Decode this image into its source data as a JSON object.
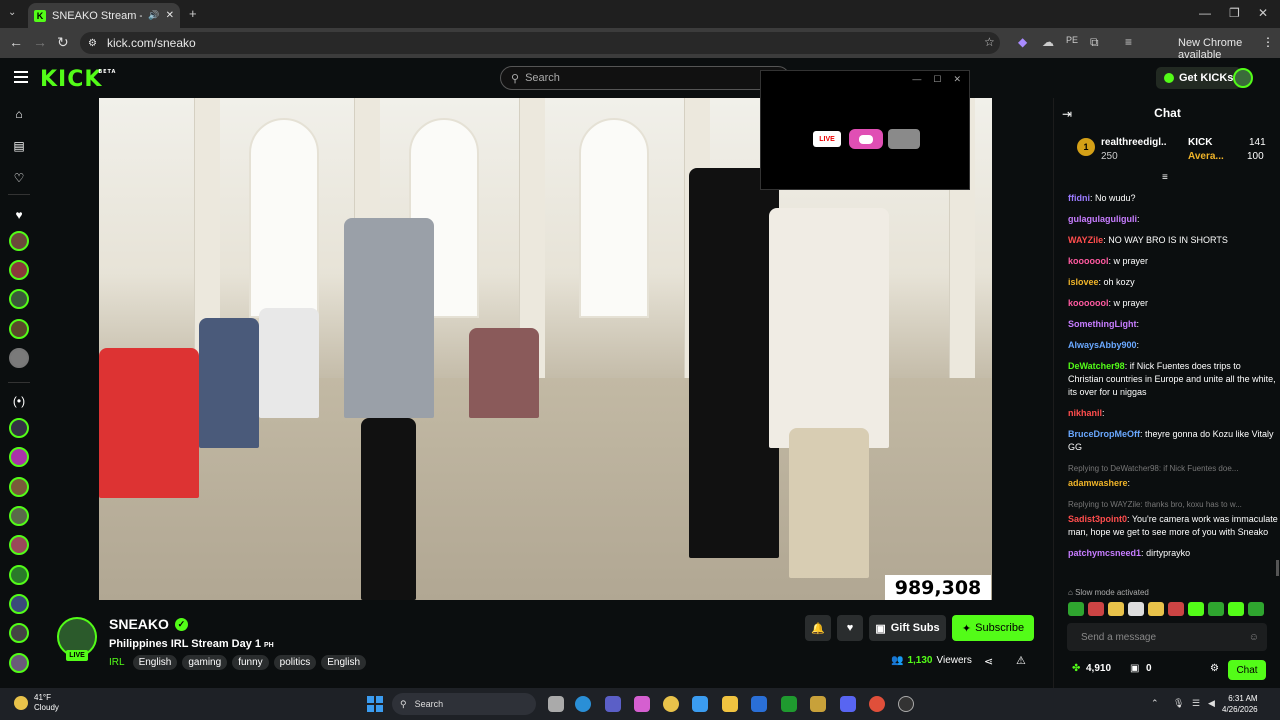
{
  "browser": {
    "tab_title": "SNEAKO Stream - Watch Li",
    "url": "kick.com/sneako",
    "new_chrome": "New Chrome available"
  },
  "header": {
    "logo": "KICK",
    "logo_badge": "BETA",
    "search_placeholder": "Search",
    "get_kicks": "Get KICKs"
  },
  "player": {
    "viewer_overlay": "989,308",
    "overlay_live": "LIVE"
  },
  "channel": {
    "name": "SNEAKO",
    "live_badge": "LIVE",
    "title": "Philippines IRL Stream Day 1",
    "title_flag": "PH",
    "category": "IRL",
    "tags": [
      "English",
      "gaming",
      "funny",
      "politics",
      "English"
    ],
    "gift_subs": "Gift Subs",
    "subscribe": "Subscribe",
    "viewers_count": "1,130",
    "viewers_label": "Viewers"
  },
  "chat": {
    "title": "Chat",
    "leaderboard": [
      {
        "rank": "1",
        "name": "realthreedigl...",
        "value": "250"
      },
      {
        "name": "KICK",
        "value": "141"
      },
      {
        "name": "Avera...",
        "value": "100"
      }
    ],
    "messages": [
      {
        "user": "ffidni",
        "color": "#9b7bff",
        "text": "No wudu?"
      },
      {
        "user": "gulagulaguliguli",
        "color": "#c77dff",
        "text": ""
      },
      {
        "user": "WAYZile",
        "color": "#ff4d4d",
        "text": "NO WAY BRO IS IN SHORTS"
      },
      {
        "user": "kooooool",
        "color": "#ff5aa0",
        "text": "w prayer"
      },
      {
        "user": "islovee",
        "color": "#f0b429",
        "text": "oh kozy"
      },
      {
        "user": "kooooool",
        "color": "#ff5aa0",
        "text": "w prayer"
      },
      {
        "user": "SomethingLight",
        "color": "#c77dff",
        "text": ""
      },
      {
        "user": "AlwaysAbby900",
        "color": "#6aa8ff",
        "text": ""
      },
      {
        "user": "DeWatcher98",
        "color": "#53fc18",
        "text": "if Nick Fuentes does trips to Christian countries in Europe and unite all the white, its over for u niggas"
      },
      {
        "user": "nikhanil",
        "color": "#ff4d4d",
        "text": ""
      },
      {
        "user": "BruceDropMeOff",
        "color": "#6aa8ff",
        "text": "theyre gonna do Kozu like Vitaly GG"
      },
      {
        "reply": "Replying to DeWatcher98: if Nick Fuentes doe..."
      },
      {
        "user": "adamwashere",
        "color": "#f0b429",
        "text": ""
      },
      {
        "reply": "Replying to WAYZile: thanks bro, koxu has to w..."
      },
      {
        "user": "Sadist3point0",
        "color": "#ff4d4d",
        "text": "You're camera work was immaculate man, hope we get to see more of you with Sneako"
      },
      {
        "user": "patchymcsneed1",
        "color": "#c77dff",
        "text": "dirtyprayko"
      }
    ],
    "slow_mode": "Slow mode activated",
    "input_placeholder": "Send a message",
    "points": "4,910",
    "drops": "0",
    "chat_button": "Chat"
  },
  "taskbar": {
    "temp": "41°F",
    "weather": "Cloudy",
    "search": "Search",
    "time": "6:31 AM",
    "date": "4/26/2026"
  },
  "colors": {
    "accent": "#53fc18",
    "background": "#0b0e0f"
  }
}
